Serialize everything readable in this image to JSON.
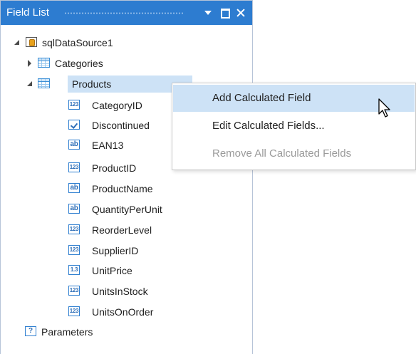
{
  "panel": {
    "title": "Field List",
    "buttons": [
      "dropdown-menu",
      "maximize",
      "close"
    ]
  },
  "tree": {
    "datasource": "sqlDataSource1",
    "categories": "Categories",
    "products": "Products",
    "fields": [
      {
        "label": "CategoryID",
        "type": "int",
        "icon": "integer-field-icon"
      },
      {
        "label": "Discontinued",
        "type": "bool",
        "icon": "boolean-field-icon"
      },
      {
        "label": "EAN13",
        "type": "str",
        "icon": "string-field-icon"
      },
      {
        "label": "ProductID",
        "type": "int",
        "icon": "integer-field-icon"
      },
      {
        "label": "ProductName",
        "type": "str",
        "icon": "string-field-icon"
      },
      {
        "label": "QuantityPerUnit",
        "type": "str",
        "icon": "string-field-icon"
      },
      {
        "label": "ReorderLevel",
        "type": "int",
        "icon": "integer-field-icon"
      },
      {
        "label": "SupplierID",
        "type": "int",
        "icon": "integer-field-icon"
      },
      {
        "label": "UnitPrice",
        "type": "dec",
        "icon": "decimal-field-icon"
      },
      {
        "label": "UnitsInStock",
        "type": "int",
        "icon": "integer-field-icon"
      },
      {
        "label": "UnitsOnOrder",
        "type": "int",
        "icon": "integer-field-icon"
      }
    ],
    "parameters": "Parameters"
  },
  "context_menu": {
    "items": [
      {
        "label": "Add Calculated Field",
        "state": "hover"
      },
      {
        "label": "Edit Calculated Fields...",
        "state": "normal"
      },
      {
        "label": "Remove All Calculated Fields",
        "state": "disabled"
      }
    ]
  },
  "colors": {
    "titlebar": "#2d7cd0",
    "selection": "#cde2f6",
    "disabled_text": "#9a9a9a"
  }
}
